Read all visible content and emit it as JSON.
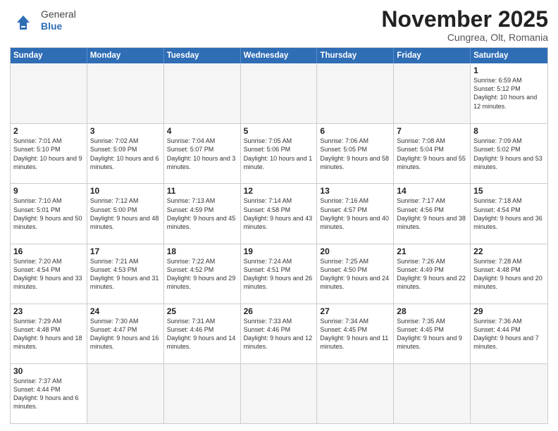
{
  "header": {
    "logo_general": "General",
    "logo_blue": "Blue",
    "title": "November 2025",
    "subtitle": "Cungrea, Olt, Romania"
  },
  "weekdays": [
    "Sunday",
    "Monday",
    "Tuesday",
    "Wednesday",
    "Thursday",
    "Friday",
    "Saturday"
  ],
  "weeks": [
    [
      {
        "day": "",
        "info": "",
        "empty": true
      },
      {
        "day": "",
        "info": "",
        "empty": true
      },
      {
        "day": "",
        "info": "",
        "empty": true
      },
      {
        "day": "",
        "info": "",
        "empty": true
      },
      {
        "day": "",
        "info": "",
        "empty": true
      },
      {
        "day": "",
        "info": "",
        "empty": true
      },
      {
        "day": "1",
        "info": "Sunrise: 6:59 AM\nSunset: 5:12 PM\nDaylight: 10 hours and 12 minutes.",
        "empty": false
      }
    ],
    [
      {
        "day": "2",
        "info": "Sunrise: 7:01 AM\nSunset: 5:10 PM\nDaylight: 10 hours and 9 minutes.",
        "empty": false
      },
      {
        "day": "3",
        "info": "Sunrise: 7:02 AM\nSunset: 5:09 PM\nDaylight: 10 hours and 6 minutes.",
        "empty": false
      },
      {
        "day": "4",
        "info": "Sunrise: 7:04 AM\nSunset: 5:07 PM\nDaylight: 10 hours and 3 minutes.",
        "empty": false
      },
      {
        "day": "5",
        "info": "Sunrise: 7:05 AM\nSunset: 5:06 PM\nDaylight: 10 hours and 1 minute.",
        "empty": false
      },
      {
        "day": "6",
        "info": "Sunrise: 7:06 AM\nSunset: 5:05 PM\nDaylight: 9 hours and 58 minutes.",
        "empty": false
      },
      {
        "day": "7",
        "info": "Sunrise: 7:08 AM\nSunset: 5:04 PM\nDaylight: 9 hours and 55 minutes.",
        "empty": false
      },
      {
        "day": "8",
        "info": "Sunrise: 7:09 AM\nSunset: 5:02 PM\nDaylight: 9 hours and 53 minutes.",
        "empty": false
      }
    ],
    [
      {
        "day": "9",
        "info": "Sunrise: 7:10 AM\nSunset: 5:01 PM\nDaylight: 9 hours and 50 minutes.",
        "empty": false
      },
      {
        "day": "10",
        "info": "Sunrise: 7:12 AM\nSunset: 5:00 PM\nDaylight: 9 hours and 48 minutes.",
        "empty": false
      },
      {
        "day": "11",
        "info": "Sunrise: 7:13 AM\nSunset: 4:59 PM\nDaylight: 9 hours and 45 minutes.",
        "empty": false
      },
      {
        "day": "12",
        "info": "Sunrise: 7:14 AM\nSunset: 4:58 PM\nDaylight: 9 hours and 43 minutes.",
        "empty": false
      },
      {
        "day": "13",
        "info": "Sunrise: 7:16 AM\nSunset: 4:57 PM\nDaylight: 9 hours and 40 minutes.",
        "empty": false
      },
      {
        "day": "14",
        "info": "Sunrise: 7:17 AM\nSunset: 4:56 PM\nDaylight: 9 hours and 38 minutes.",
        "empty": false
      },
      {
        "day": "15",
        "info": "Sunrise: 7:18 AM\nSunset: 4:54 PM\nDaylight: 9 hours and 36 minutes.",
        "empty": false
      }
    ],
    [
      {
        "day": "16",
        "info": "Sunrise: 7:20 AM\nSunset: 4:54 PM\nDaylight: 9 hours and 33 minutes.",
        "empty": false
      },
      {
        "day": "17",
        "info": "Sunrise: 7:21 AM\nSunset: 4:53 PM\nDaylight: 9 hours and 31 minutes.",
        "empty": false
      },
      {
        "day": "18",
        "info": "Sunrise: 7:22 AM\nSunset: 4:52 PM\nDaylight: 9 hours and 29 minutes.",
        "empty": false
      },
      {
        "day": "19",
        "info": "Sunrise: 7:24 AM\nSunset: 4:51 PM\nDaylight: 9 hours and 26 minutes.",
        "empty": false
      },
      {
        "day": "20",
        "info": "Sunrise: 7:25 AM\nSunset: 4:50 PM\nDaylight: 9 hours and 24 minutes.",
        "empty": false
      },
      {
        "day": "21",
        "info": "Sunrise: 7:26 AM\nSunset: 4:49 PM\nDaylight: 9 hours and 22 minutes.",
        "empty": false
      },
      {
        "day": "22",
        "info": "Sunrise: 7:28 AM\nSunset: 4:48 PM\nDaylight: 9 hours and 20 minutes.",
        "empty": false
      }
    ],
    [
      {
        "day": "23",
        "info": "Sunrise: 7:29 AM\nSunset: 4:48 PM\nDaylight: 9 hours and 18 minutes.",
        "empty": false
      },
      {
        "day": "24",
        "info": "Sunrise: 7:30 AM\nSunset: 4:47 PM\nDaylight: 9 hours and 16 minutes.",
        "empty": false
      },
      {
        "day": "25",
        "info": "Sunrise: 7:31 AM\nSunset: 4:46 PM\nDaylight: 9 hours and 14 minutes.",
        "empty": false
      },
      {
        "day": "26",
        "info": "Sunrise: 7:33 AM\nSunset: 4:46 PM\nDaylight: 9 hours and 12 minutes.",
        "empty": false
      },
      {
        "day": "27",
        "info": "Sunrise: 7:34 AM\nSunset: 4:45 PM\nDaylight: 9 hours and 11 minutes.",
        "empty": false
      },
      {
        "day": "28",
        "info": "Sunrise: 7:35 AM\nSunset: 4:45 PM\nDaylight: 9 hours and 9 minutes.",
        "empty": false
      },
      {
        "day": "29",
        "info": "Sunrise: 7:36 AM\nSunset: 4:44 PM\nDaylight: 9 hours and 7 minutes.",
        "empty": false
      }
    ],
    [
      {
        "day": "30",
        "info": "Sunrise: 7:37 AM\nSunset: 4:44 PM\nDaylight: 9 hours and 6 minutes.",
        "empty": false
      },
      {
        "day": "",
        "info": "",
        "empty": true
      },
      {
        "day": "",
        "info": "",
        "empty": true
      },
      {
        "day": "",
        "info": "",
        "empty": true
      },
      {
        "day": "",
        "info": "",
        "empty": true
      },
      {
        "day": "",
        "info": "",
        "empty": true
      },
      {
        "day": "",
        "info": "",
        "empty": true
      }
    ]
  ]
}
